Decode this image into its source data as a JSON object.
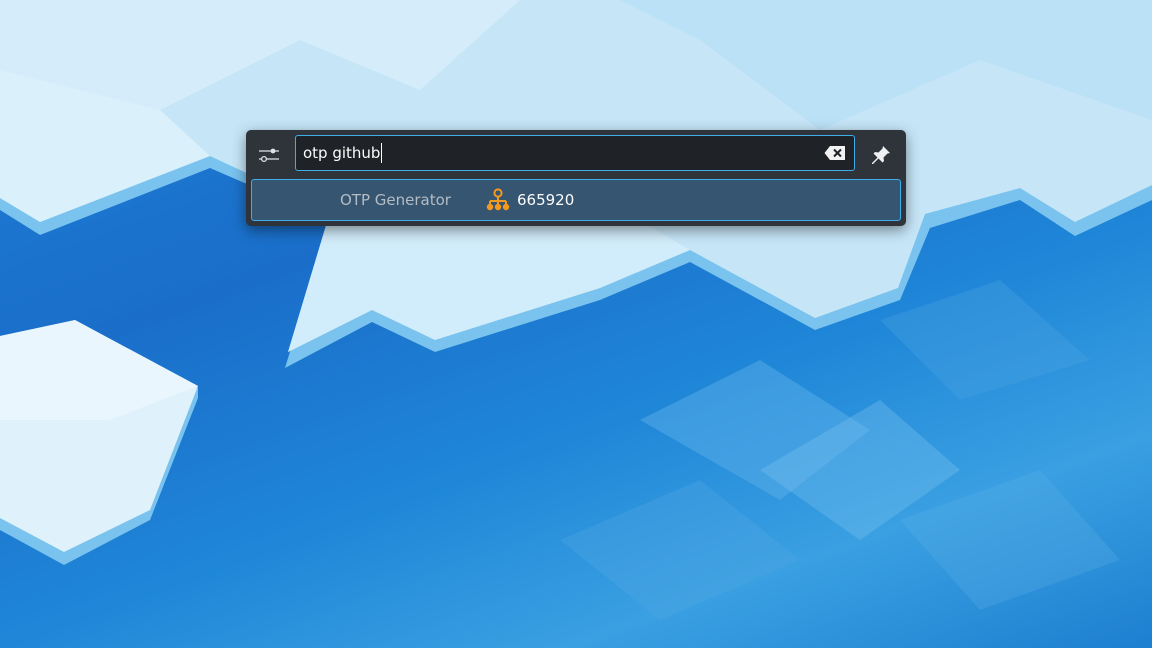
{
  "search": {
    "query": "otp github"
  },
  "results": [
    {
      "category": "OTP Generator",
      "icon": "otp-key-icon",
      "text": "665920"
    }
  ],
  "colors": {
    "panel_bg": "#2f343b",
    "field_bg": "#1f2328",
    "accent": "#3daee9",
    "selected_row": "#365571",
    "icon_orange": "#f29a1e"
  },
  "icons": {
    "config": "sliders-icon",
    "clear": "clear-text-icon",
    "pin": "pin-icon"
  }
}
